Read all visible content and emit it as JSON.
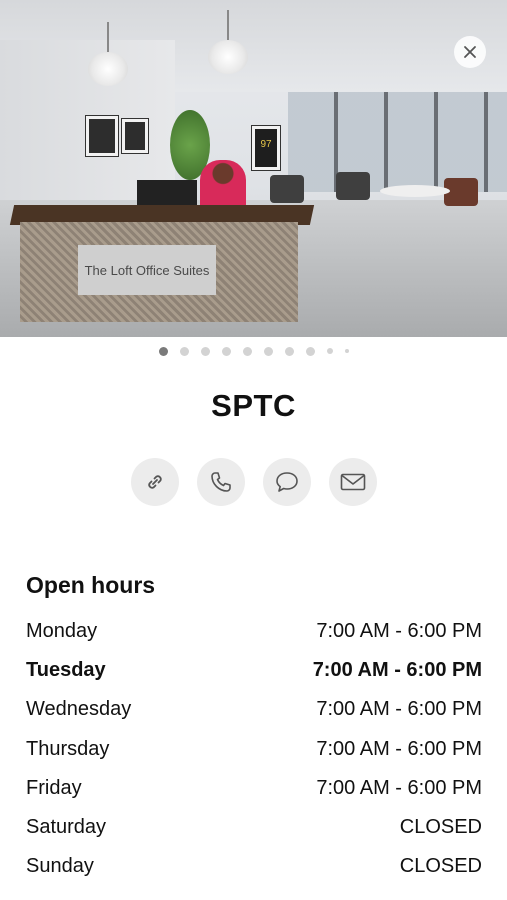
{
  "hero": {
    "sign_text": "The Loft Office Suites",
    "jersey_number": "97",
    "close_icon": "close-icon"
  },
  "carousel": {
    "page_count": 10,
    "active_index": 0
  },
  "place": {
    "name": "SPTC"
  },
  "actions": [
    {
      "name": "link-button",
      "icon": "link-icon"
    },
    {
      "name": "call-button",
      "icon": "phone-icon"
    },
    {
      "name": "message-button",
      "icon": "chat-bubble-icon"
    },
    {
      "name": "email-button",
      "icon": "envelope-icon"
    }
  ],
  "open_hours": {
    "title": "Open hours",
    "days": [
      {
        "day": "Monday",
        "hours": "7:00 AM - 6:00 PM"
      },
      {
        "day": "Tuesday",
        "hours": "7:00 AM - 6:00 PM",
        "today": true
      },
      {
        "day": "Wednesday",
        "hours": "7:00 AM - 6:00 PM"
      },
      {
        "day": "Thursday",
        "hours": "7:00 AM - 6:00 PM"
      },
      {
        "day": "Friday",
        "hours": "7:00 AM - 6:00 PM"
      },
      {
        "day": "Saturday",
        "hours": "CLOSED"
      },
      {
        "day": "Sunday",
        "hours": "CLOSED"
      }
    ]
  },
  "colors": {
    "dot_active": "#7a7a7a",
    "dot_inactive": "#d3d3d3",
    "action_bg": "#ececec",
    "icon_stroke": "#555555"
  }
}
